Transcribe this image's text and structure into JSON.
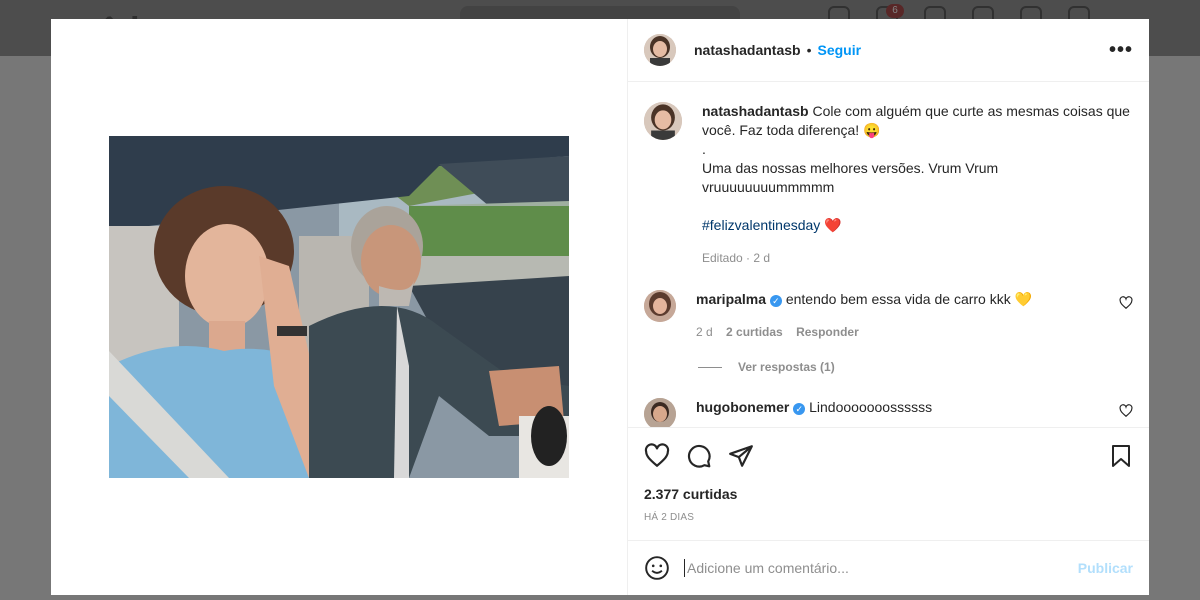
{
  "post": {
    "username": "natashadantasb",
    "follow_label": "Seguir",
    "dot": "•",
    "more_label": "•••",
    "caption_lines": [
      "Cole com alguém que curte as mesmas coisas que você. Faz toda diferença! 😛",
      ".",
      "Uma das nossas melhores versões. Vrum Vrum vruuuuuuuummmmm"
    ],
    "hashtag": "#felizvalentinesday",
    "hashtag_emoji": "❤️",
    "edited": "Editado · 2 d",
    "likes": "2.377 curtidas",
    "posted": "HÁ 2 DIAS"
  },
  "comments": [
    {
      "username": "maripalma",
      "verified": "✓",
      "text": "entendo bem essa vida de carro kkk 💛",
      "time": "2 d",
      "likes": "2 curtidas",
      "reply": "Responder",
      "view_replies": "Ver respostas (1)"
    },
    {
      "username": "hugobonemer",
      "verified": "✓",
      "text": "Lindooooooossssss"
    }
  ],
  "composer": {
    "placeholder": "Adicione um comentário...",
    "publish": "Publicar"
  },
  "background": {
    "notification_count": "6"
  },
  "colors": {
    "accent": "#0095f6",
    "publish_disabled": "#b2dffc",
    "verified": "#3897f0",
    "hashtag": "#00376b"
  },
  "icons": [
    "heart-icon",
    "comment-icon",
    "share-icon",
    "bookmark-icon",
    "emoji-icon",
    "more-icon",
    "verified-icon"
  ]
}
